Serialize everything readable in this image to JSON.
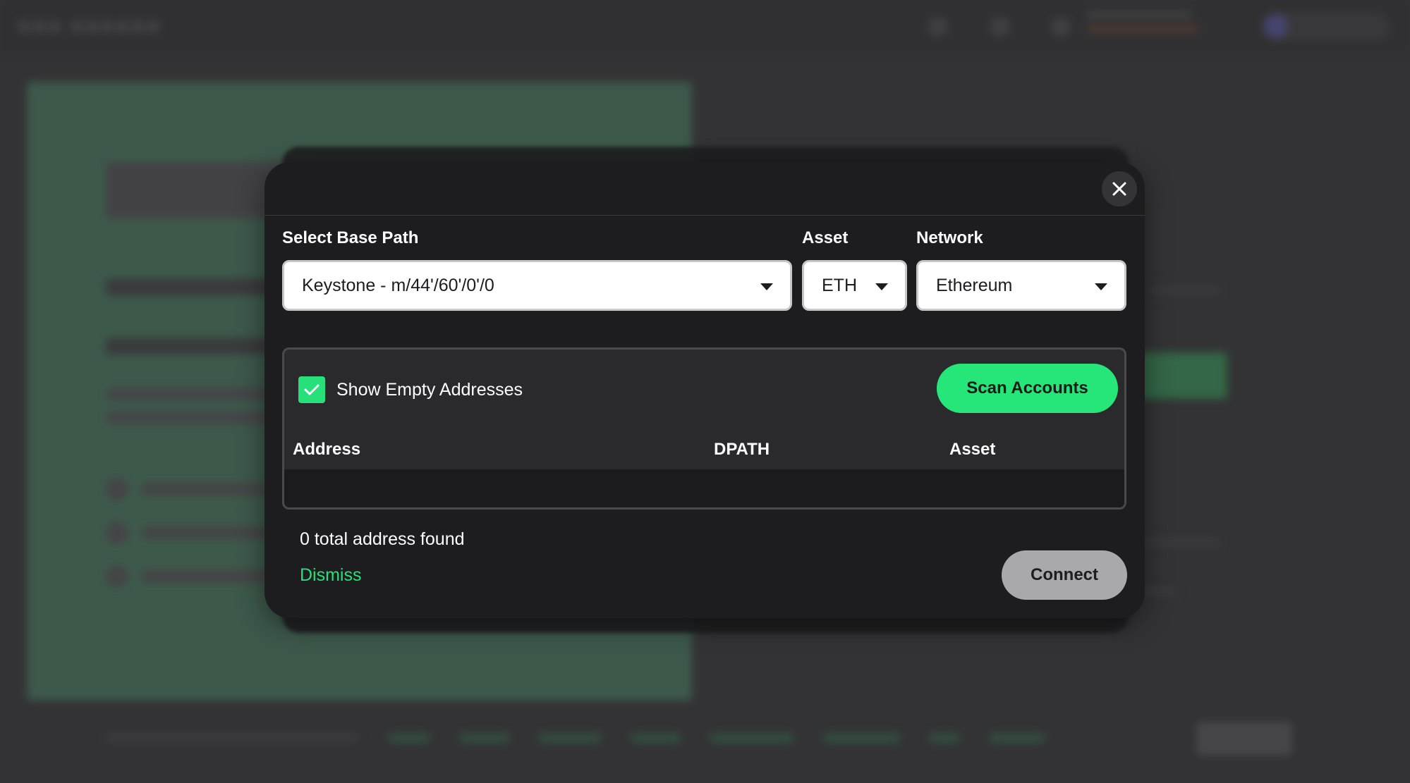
{
  "modal": {
    "close_icon": "close-icon",
    "base_path": {
      "label": "Select Base Path",
      "value": "Keystone - m/44'/60'/0'/0"
    },
    "asset": {
      "label": "Asset",
      "value": "ETH"
    },
    "network": {
      "label": "Network",
      "value": "Ethereum"
    },
    "show_empty": {
      "label": "Show Empty Addresses",
      "checked": true
    },
    "scan_button": "Scan Accounts",
    "table": {
      "columns": [
        "Address",
        "DPATH",
        "Asset"
      ],
      "rows": []
    },
    "found_text": "0 total address found",
    "dismiss_label": "Dismiss",
    "connect_label": "Connect"
  },
  "colors": {
    "accent": "#26e679",
    "modal_bg": "#1d1d1f",
    "connect_disabled": "#a9a9ad"
  }
}
